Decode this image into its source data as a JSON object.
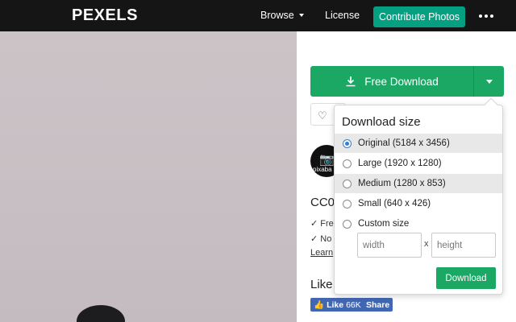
{
  "header": {
    "logo": "PEXELS",
    "browse": "Browse",
    "license": "License",
    "contribute": "Contribute Photos"
  },
  "download": {
    "free_download": "Free Download"
  },
  "author": {
    "avatar_text": "pixaba"
  },
  "license": {
    "title": "CC0",
    "line1": "✓ Free",
    "line2": "✓ No a",
    "learn_more": "Learn"
  },
  "like": {
    "title": "Like",
    "fb_like": "Like",
    "fb_count": "66K",
    "fb_share": "Share"
  },
  "dropdown": {
    "title": "Download size",
    "options": [
      {
        "label": "Original (5184 x 3456)",
        "selected": true
      },
      {
        "label": "Large (1920 x 1280)",
        "selected": false
      },
      {
        "label": "Medium (1280 x 853)",
        "selected": false
      },
      {
        "label": "Small (640 x 426)",
        "selected": false
      },
      {
        "label": "Custom size",
        "selected": false
      }
    ],
    "width_placeholder": "width",
    "height_placeholder": "height",
    "times": "x",
    "download_button": "Download"
  },
  "colors": {
    "brand_green": "#1aa864",
    "header_bg": "#151515",
    "facebook_blue": "#4267b2",
    "radio_selected": "#2f7ed8"
  }
}
